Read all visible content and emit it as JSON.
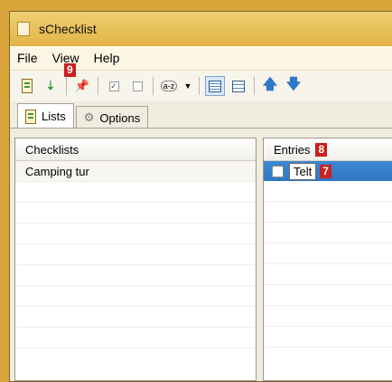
{
  "window": {
    "title": "sChecklist"
  },
  "menu": {
    "file": "File",
    "view": "View",
    "help": "Help"
  },
  "toolbar": {
    "icons": [
      "new-checklist-icon",
      "new-entry-icon",
      "pin-icon",
      "check-icon",
      "uncheck-icon",
      "sort-icon",
      "dropdown-icon",
      "grid-view-icon",
      "list-view-icon",
      "move-up-icon",
      "move-down-icon"
    ],
    "sort_label": "a-z"
  },
  "badges": {
    "toolbar": "9",
    "entries": "8",
    "entry": "7"
  },
  "tabs": [
    {
      "label": "Lists"
    },
    {
      "label": "Options"
    }
  ],
  "checklists": {
    "header": "Checklists",
    "items": [
      "Camping tur"
    ]
  },
  "entries": {
    "header": "Entries",
    "items": [
      {
        "label": "Telt",
        "checked": false,
        "selected": true
      }
    ]
  },
  "colors": {
    "selection": "#3d88d3",
    "badge": "#c8211f",
    "titlebar": "#e2b447"
  }
}
